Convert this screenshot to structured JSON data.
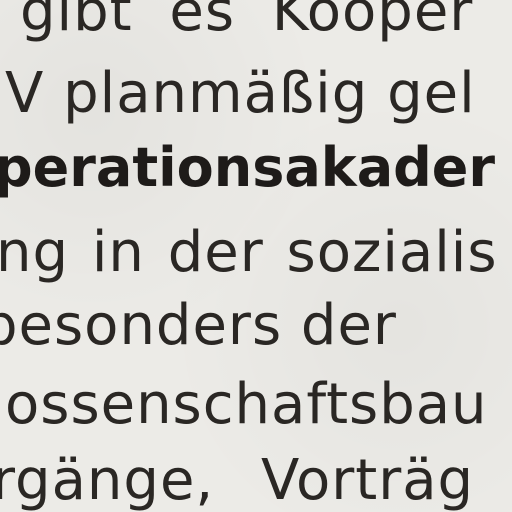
{
  "document": {
    "lines": [
      "gibt es Kooper",
      "V planmäßig gel",
      "perationsakader",
      "ng in der sozialis",
      "besonders der",
      "ossenschaftsbau",
      "rgänge, Vorträg"
    ]
  }
}
